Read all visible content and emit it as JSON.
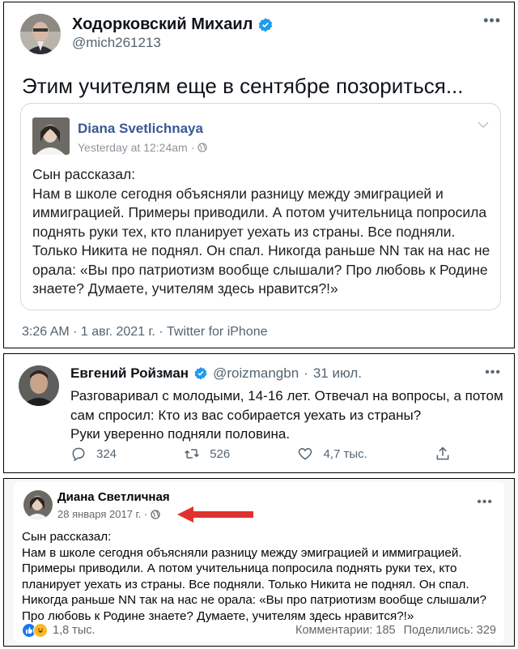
{
  "tweet1": {
    "author_name": "Ходорковский Михаил",
    "handle": "@mich261213",
    "more_icon": "more-dots-icon",
    "text": "Этим учителям еще в сентябре позориться...",
    "embed": {
      "author_name": "Diana Svetlichnaya",
      "time": "Yesterday at 12:24am · ",
      "body": "Сын рассказал:\nНам в школе сегодня объясняли разницу между эмиграцией и иммиграцией. Примеры приводили. А потом учительница попросила поднять руки тех, кто планирует уехать из страны. Все подняли. Только Никита не поднял. Он спал. Никогда раньше NN так на нас не орала: «Вы про патриотизм вообще слышали? Про любовь к Родине знаете? Думаете, учителям здесь нравится?!»"
    },
    "meta": "3:26 AM · 1 авг. 2021 г. · Twitter for iPhone"
  },
  "tweet2": {
    "author_name": "Евгений Ройзман",
    "handle": "@roizmangbn",
    "separator": "·",
    "date": "31 июл.",
    "body": "Разговаривал с молодыми, 14-16 лет. Отвечал на вопросы, а потом\nсам спросил: Кто из вас собирается уехать из страны?\nРуки уверенно подняли половина.",
    "replies": "324",
    "retweets": "526",
    "likes": "4,7 тыс."
  },
  "fbpost": {
    "author_name": "Диана Светличная",
    "date": "28 января 2017 г. · ",
    "body": "Сын рассказал:\nНам в школе сегодня объясняли разницу между эмиграцией и иммиграцией. Примеры приводили. А потом учительница попросила поднять руки тех, кто  планирует уехать из страны. Все подняли. Только Никита не поднял. Он спал. Никогда раньше NN так на нас не орала: «Вы про патриотизм вообще слышали? Про любовь к Родине знаете? Думаете, учителям здесь нравится?!»",
    "reactions": "1,8 тыс.",
    "comments": "Комментарии: 185",
    "shares": "Поделились: 329"
  },
  "colors": {
    "verified": "#1d9bf0",
    "fb_link": "#385898",
    "arrow": "#e0322d"
  }
}
